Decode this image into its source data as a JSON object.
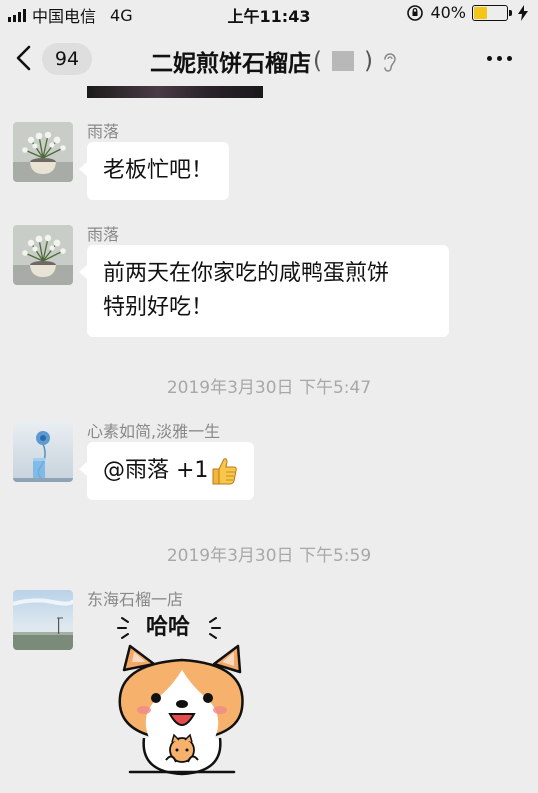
{
  "status_bar": {
    "carrier": "中国电信",
    "network": "4G",
    "time": "上午11:43",
    "battery_percent": "40%",
    "battery_level": 0.4
  },
  "nav": {
    "unread_count": "94",
    "title": "二妮煎饼石榴店",
    "title_paren_open": "(",
    "title_paren_close": ")"
  },
  "messages": [
    {
      "sender": "雨落",
      "text": "老板忙吧！",
      "avatar": "flower-pot-avatar"
    },
    {
      "sender": "雨落",
      "text_line1": "前两天在你家吃的咸鸭蛋煎饼",
      "text_line2": "特别好吃！",
      "avatar": "flower-pot-avatar"
    },
    {
      "sender": "心素如简,淡雅一生",
      "text": "@雨落 +1",
      "avatar": "blue-flower-vase-avatar"
    },
    {
      "sender": "东海石榴一店",
      "avatar": "sky-landscape-avatar",
      "sticker_text": "哈哈"
    }
  ],
  "timestamps": [
    "2019年3月30日 下午5:47",
    "2019年3月30日 下午5:59"
  ],
  "colors": {
    "background": "#ededed",
    "bubble": "#ffffff",
    "battery": "#f2c617"
  }
}
